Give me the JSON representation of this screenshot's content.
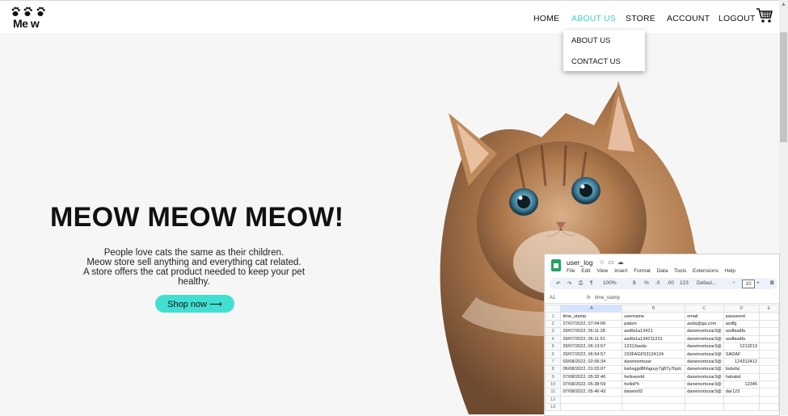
{
  "brand": {
    "logo_text": "Me  w",
    "logo_icon": "paw-prints-icon"
  },
  "nav": {
    "items": [
      "HOME",
      "ABOUT US",
      "STORE",
      "ACCOUNT",
      "LOGOUT"
    ],
    "active": "ABOUT US",
    "cart_icon": "shopping-cart-icon"
  },
  "dropdown": {
    "items": [
      "ABOUT US",
      "CONTACT US"
    ]
  },
  "hero": {
    "title": "MEOW MEOW MEOW!",
    "lines": [
      "People love cats the same as their children.",
      "Meow store sell anything and everything cat related.",
      "A store offers the cat product needed to keep your pet healthy."
    ],
    "button": "Shop now ⟶",
    "image": "kitten-photo"
  },
  "colors": {
    "accent": "#41cfd0",
    "button": "#41dfd1",
    "background": "#f6f6f6"
  },
  "sheet": {
    "title": "user_log",
    "menu": [
      "File",
      "Edit",
      "View",
      "Insert",
      "Format",
      "Data",
      "Tools",
      "Extensions",
      "Help"
    ],
    "zoom": "100%",
    "currency": "$",
    "percent": "%",
    "dec_minus": ".0",
    "dec_plus": ".00",
    "num_format": "123",
    "font": "Defaul...",
    "font_size": "10",
    "minus": "−",
    "plus": "+",
    "bold": "B",
    "cell_ref": "A1",
    "fx": "fx",
    "formula_value": "time_stamp",
    "columns": [
      "A",
      "B",
      "C",
      "D",
      "E"
    ],
    "rows": [
      [
        "1",
        "time_stamp",
        "username",
        "email",
        "password",
        ""
      ],
      [
        "2",
        "27/07/2022, 07:04:06",
        "pabon",
        "asda@ga.com",
        "asdfg",
        ""
      ],
      [
        "3",
        "29/07/2022, 06:11:28",
        "asdfa1a13421",
        "darwinortozar3@",
        "asdfasdfa",
        ""
      ],
      [
        "4",
        "29/07/2022, 06:11:51",
        "asdfa1a134211231",
        "darwinortozar3@",
        "asdfasdfa",
        ""
      ],
      [
        "5",
        "29/07/2022, 06:13:57",
        "12313asda",
        "darwinortozar3@",
        "1213213",
        ""
      ],
      [
        "6",
        "29/07/2022, 06:54:57",
        "153FAGF53124124",
        "darwinortozar3@",
        "SADAF",
        ""
      ],
      [
        "7",
        "03/08/2022, 02:06:34",
        "darwinortozar",
        "darwinortozar3@",
        "124312412",
        ""
      ],
      [
        "8",
        "06/08/2022, 01:03:07",
        "bahsggd8hhguyy7g87y7hjdc",
        "darwinortozar3@",
        "bsbzbz",
        ""
      ],
      [
        "9",
        "07/08/2022, 05:32:40",
        "helloworld",
        "darwinortozar3@",
        "hahabd",
        ""
      ],
      [
        "10",
        "07/08/2022, 05:38:59",
        "helloPh",
        "darwinortozar3@",
        "12345",
        ""
      ],
      [
        "11",
        "07/08/2022, 05:46:43",
        "darwin03",
        "darwinortozar3@",
        "dar123",
        ""
      ],
      [
        "12",
        "",
        "",
        "",
        "",
        ""
      ],
      [
        "13",
        "",
        "",
        "",
        "",
        ""
      ]
    ]
  }
}
